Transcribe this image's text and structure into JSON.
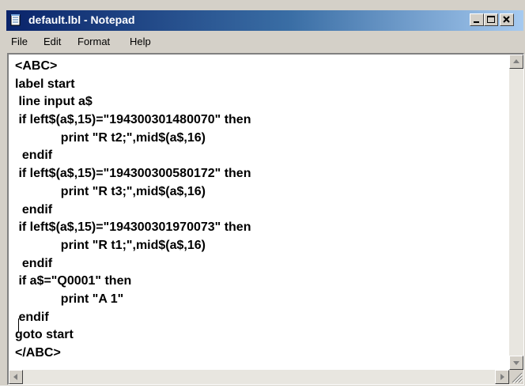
{
  "window": {
    "title": "default.lbl - Notepad"
  },
  "menu": [
    "File",
    "Edit",
    "Format",
    "Help"
  ],
  "editor": {
    "lines": [
      "<ABC>",
      "label start",
      " line input a$",
      " if left$(a$,15)=\"194300301480070\" then",
      "             print \"R t2;\",mid$(a$,16)",
      "  endif",
      " if left$(a$,15)=\"194300300580172\" then",
      "             print \"R t3;\",mid$(a$,16)",
      "  endif",
      " if left$(a$,15)=\"194300301970073\" then",
      "             print \"R t1;\",mid$(a$,16)",
      "  endif",
      " if a$=\"Q0001\" then",
      "             print \"A 1\"",
      " endif",
      "goto start",
      "</ABC>"
    ]
  },
  "icons": {
    "app": "notepad-icon",
    "minimize": "minimize-icon",
    "maximize": "maximize-icon",
    "close": "close-icon"
  }
}
